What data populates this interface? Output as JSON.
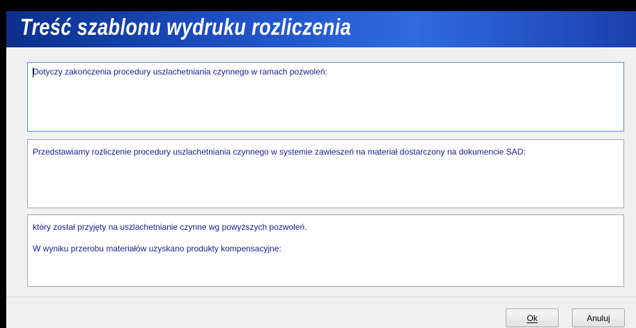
{
  "window": {
    "title": "Treść szablonu wydruku rozliczenia"
  },
  "fields": [
    {
      "lines": [
        "Dotyczy zakończenia procedury uszlachetniania czynnego w ramach pozwoleń:"
      ]
    },
    {
      "lines": [
        "Przedstawiamy rozliczenie procedury uszlachetniania czynnego w systemie zawieszeń na materiał dostarczony na dokumencie SAD:"
      ]
    },
    {
      "lines": [
        "który został przyjęty na uszlachetnianie czynne wg powyższych pozwoleń.",
        "W wyniku przerobu materiałów uzyskano produkty kompensacyjne:"
      ]
    }
  ],
  "buttons": {
    "ok_label": "Ok",
    "cancel_label": "Anuluj"
  },
  "colors": {
    "title_bar": "#1e4fc4",
    "text": "#1a1a8c"
  }
}
